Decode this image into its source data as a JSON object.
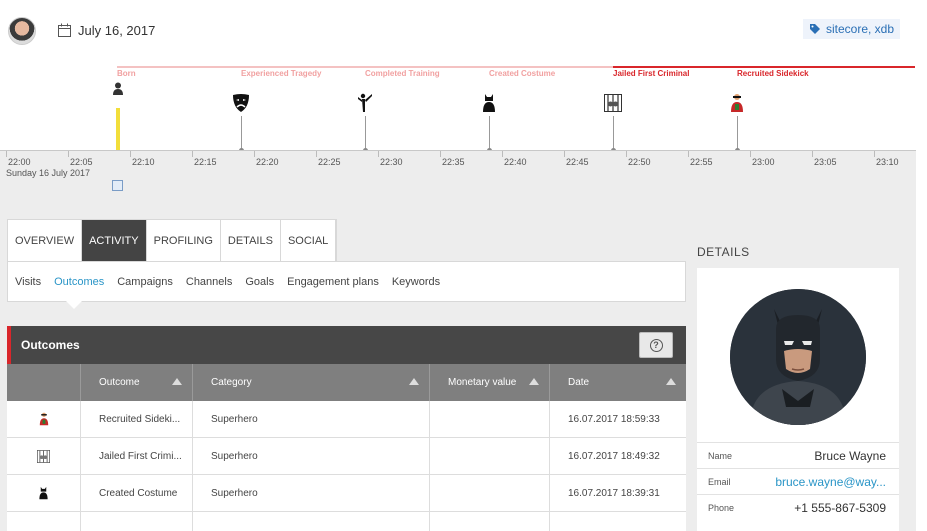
{
  "header": {
    "date": "July 16, 2017",
    "tag": "sitecore, xdb"
  },
  "timeline": {
    "events": [
      {
        "label": "Born",
        "icon": "person-icon"
      },
      {
        "label": "Experienced Tragedy",
        "icon": "theater-mask-icon"
      },
      {
        "label": "Completed Training",
        "icon": "martial-arts-icon"
      },
      {
        "label": "Created Costume",
        "icon": "costume-icon"
      },
      {
        "label": "Jailed First Criminal",
        "icon": "jail-icon"
      },
      {
        "label": "Recruited Sidekick",
        "icon": "sidekick-icon"
      }
    ],
    "ticks": [
      "22:00",
      "22:05",
      "22:10",
      "22:15",
      "22:20",
      "22:25",
      "22:30",
      "22:35",
      "22:40",
      "22:45",
      "22:50",
      "22:55",
      "23:00",
      "23:05",
      "23:10"
    ],
    "axis_date": "Sunday 16 July 2017",
    "colors": {
      "past": "#f1a1a1",
      "recent": "#d9262b",
      "marker": "#f2de3a"
    }
  },
  "tabs": [
    "OVERVIEW",
    "ACTIVITY",
    "PROFILING",
    "DETAILS",
    "SOCIAL"
  ],
  "active_tab": "ACTIVITY",
  "subtabs": [
    "Visits",
    "Outcomes",
    "Campaigns",
    "Channels",
    "Goals",
    "Engagement plans",
    "Keywords"
  ],
  "active_subtab": "Outcomes",
  "outcomes": {
    "title": "Outcomes",
    "help": "?",
    "columns": [
      "",
      "Outcome",
      "Category",
      "Monetary value",
      "Date"
    ],
    "rows": [
      {
        "icon": "sidekick-icon",
        "outcome": "Recruited Sideki...",
        "category": "Superhero",
        "value": "",
        "date": "16.07.2017 18:59:33"
      },
      {
        "icon": "jail-icon",
        "outcome": "Jailed First Crimi...",
        "category": "Superhero",
        "value": "",
        "date": "16.07.2017 18:49:32"
      },
      {
        "icon": "costume-icon",
        "outcome": "Created Costume",
        "category": "Superhero",
        "value": "",
        "date": "16.07.2017 18:39:31"
      }
    ]
  },
  "details": {
    "title": "DETAILS",
    "name_label": "Name",
    "name": "Bruce Wayne",
    "email_label": "Email",
    "email": "bruce.wayne@way...",
    "phone_label": "Phone",
    "phone": "+1 555-867-5309"
  }
}
